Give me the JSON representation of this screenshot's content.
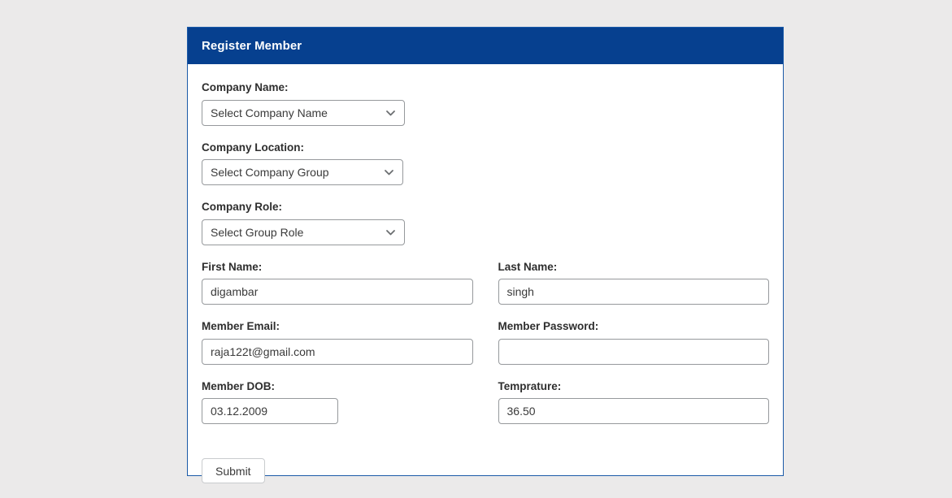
{
  "page": {
    "background_color": "#ebeaea"
  },
  "card": {
    "border_color": "#1a5aa8",
    "header": {
      "title": "Register Member",
      "background_color": "#06408f",
      "text_color": "#ffffff"
    }
  },
  "form": {
    "fields": [
      {
        "key": "company_name",
        "label": "Company Name:",
        "type": "select",
        "selected": "Select Company Name",
        "icon": "chevron-down-icon"
      },
      {
        "key": "company_location",
        "label": "Company Location:",
        "type": "select",
        "selected": "Select Company Group",
        "icon": "chevron-down-icon"
      },
      {
        "key": "company_role",
        "label": "Company Role:",
        "type": "select",
        "selected": "Select Group Role",
        "icon": "chevron-down-icon"
      },
      {
        "key": "first_name",
        "label": "First Name:",
        "type": "text",
        "value": "digambar",
        "placeholder": ""
      },
      {
        "key": "last_name",
        "label": "Last Name:",
        "type": "text",
        "value": "singh",
        "placeholder": ""
      },
      {
        "key": "member_email",
        "label": "Member Email:",
        "type": "text",
        "value": "raja122t@gmail.com",
        "placeholder": ""
      },
      {
        "key": "member_password",
        "label": "Member Password:",
        "type": "password",
        "value": "",
        "placeholder": ""
      },
      {
        "key": "member_dob",
        "label": "Member DOB:",
        "type": "text",
        "value": "03.12.2009",
        "placeholder": ""
      },
      {
        "key": "temprature",
        "label": "Temprature:",
        "type": "text",
        "value": "36.50",
        "placeholder": ""
      }
    ],
    "submit_label": "Submit"
  }
}
